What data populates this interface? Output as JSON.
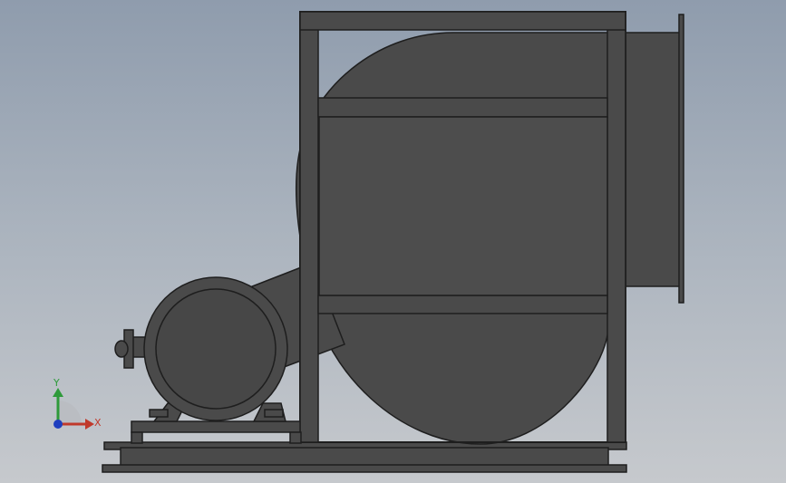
{
  "viewport": {
    "background_top": "#8f9cad",
    "background_bottom": "#c6c9cd"
  },
  "model": {
    "body_color": "#4a4a4a",
    "edge_color": "#1e1e1e",
    "housing_color": "#505050"
  },
  "triad": {
    "x_label": "X",
    "y_label": "Y",
    "x_color": "#c0392b",
    "y_color": "#2e9a3a",
    "z_color": "#1f3fbf"
  }
}
